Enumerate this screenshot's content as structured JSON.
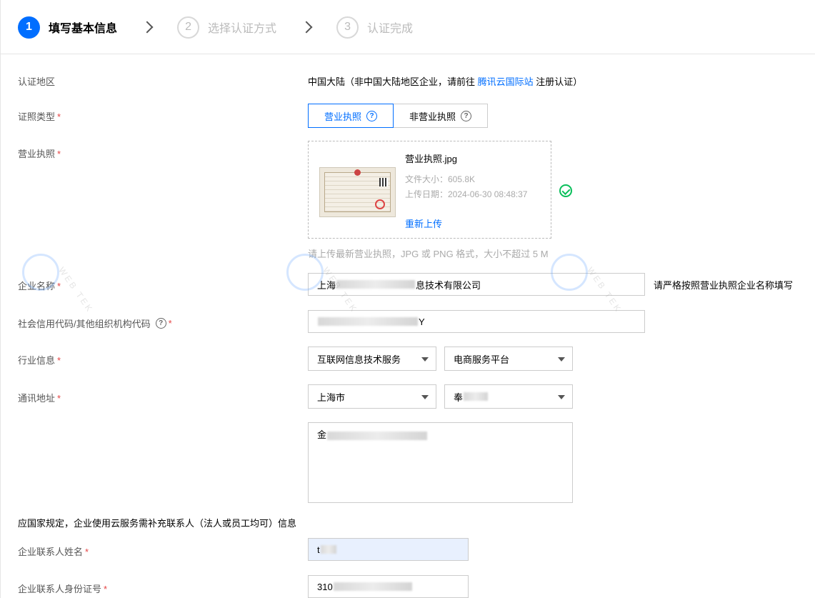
{
  "stepper": {
    "steps": [
      {
        "num": "1",
        "label": "填写基本信息"
      },
      {
        "num": "2",
        "label": "选择认证方式"
      },
      {
        "num": "3",
        "label": "认证完成"
      }
    ]
  },
  "region": {
    "label": "认证地区",
    "value_prefix": "中国大陆（非中国大陆地区企业，请前往 ",
    "link": "腾讯云国际站",
    "value_suffix": " 注册认证）"
  },
  "license_type": {
    "label": "证照类型",
    "required": "*",
    "options": [
      "营业执照",
      "非营业执照"
    ],
    "help_glyph": "?"
  },
  "license": {
    "label": "营业执照",
    "required": "*",
    "file_name": "营业执照.jpg",
    "file_size": "文件大小：605.8K",
    "upload_date": "上传日期：2024-06-30 08:48:37",
    "reupload": "重新上传",
    "hint": "请上传最新营业执照，JPG 或 PNG 格式，大小不超过 5 M"
  },
  "company_name": {
    "label": "企业名称",
    "required": "*",
    "value_start": "上海",
    "value_end": "息技术有限公司",
    "note": "请严格按照营业执照企业名称填写"
  },
  "credit_code": {
    "label": "社会信用代码/其他组织机构代码",
    "required": "*",
    "value_end": "Y"
  },
  "industry": {
    "label": "行业信息",
    "required": "*",
    "primary": "互联网信息技术服务",
    "secondary": "电商服务平台"
  },
  "address": {
    "label": "通讯地址",
    "required": "*",
    "city": "上海市",
    "district_start": "奉",
    "detail_start": "金"
  },
  "notice": "应国家规定，企业使用云服务需补充联系人（法人或员工均可）信息",
  "contact_name": {
    "label": "企业联系人姓名",
    "required": "*",
    "value_start": "t"
  },
  "contact_id": {
    "label": "企业联系人身份证号",
    "required": "*",
    "value_start": "310"
  },
  "watermark": {
    "text": "WEB TEK"
  },
  "colors": {
    "primary": "#006eff",
    "success": "#0abf5b",
    "required": "#e54545"
  }
}
